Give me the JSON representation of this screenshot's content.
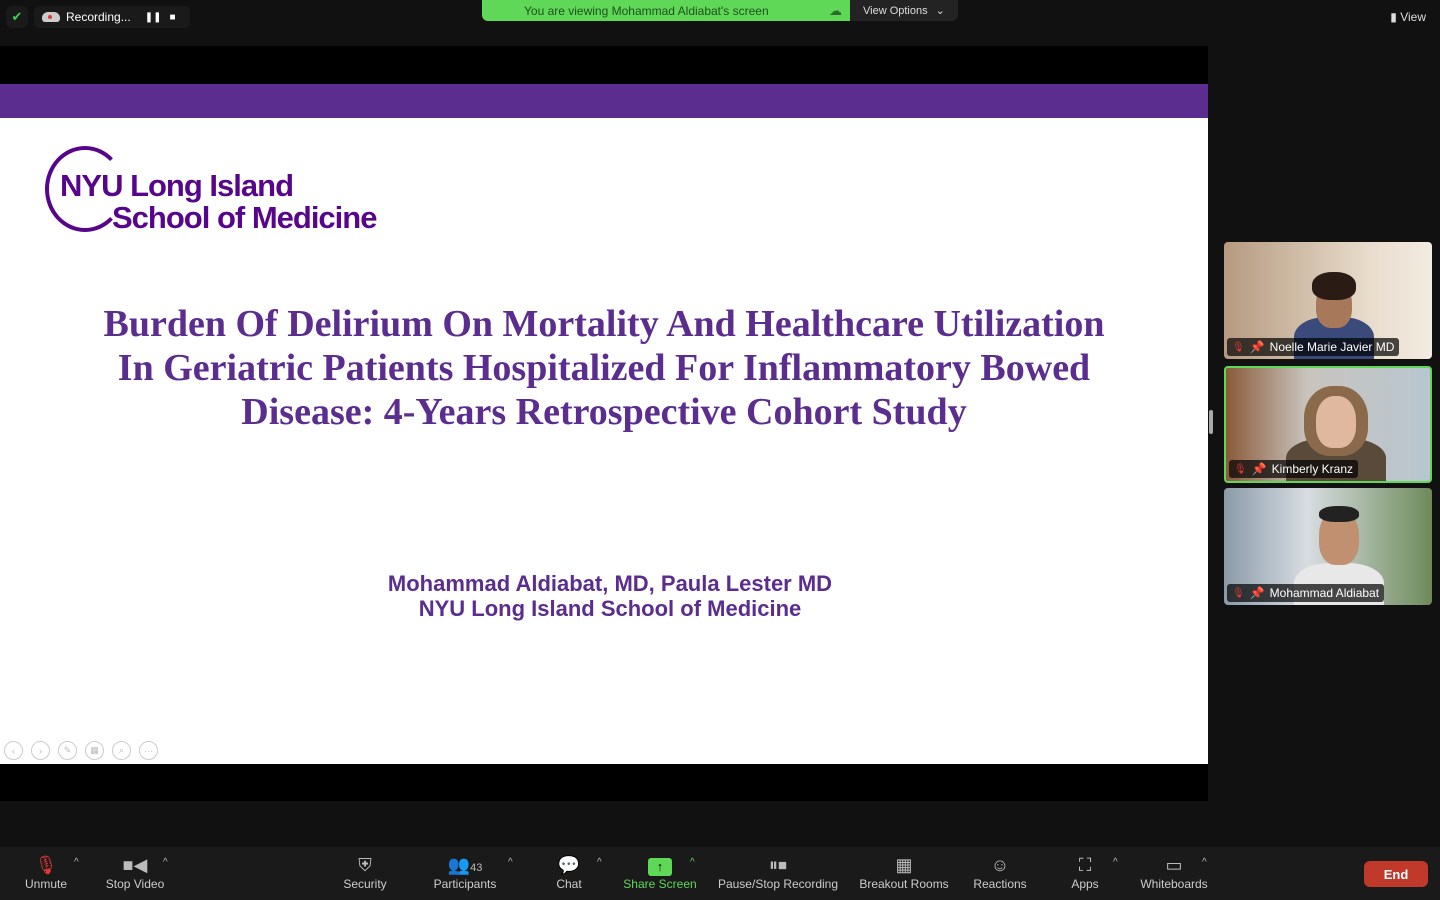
{
  "topbar": {
    "recording_label": "Recording...",
    "viewing_banner": "You are viewing Mohammad Aldiabat's screen",
    "view_options": "View Options",
    "view": "View"
  },
  "slide": {
    "logo_line1": "NYU Long Island",
    "logo_line2": "School of Medicine",
    "title": "Burden Of Delirium On Mortality And Healthcare Utilization In Geriatric Patients Hospitalized For Inflammatory Bowed Disease: 4-Years Retrospective Cohort Study",
    "authors": "Mohammad Aldiabat, MD, Paula Lester MD",
    "institution": "NYU Long Island School of Medicine"
  },
  "participants_video": [
    {
      "name": "Noelle Marie Javier MD"
    },
    {
      "name": "Kimberly Kranz"
    },
    {
      "name": "Mohammad Aldiabat"
    }
  ],
  "toolbar": {
    "unmute": "Unmute",
    "stop_video": "Stop Video",
    "security": "Security",
    "participants": "Participants",
    "participant_count": "43",
    "chat": "Chat",
    "share_screen": "Share Screen",
    "pause_stop_recording": "Pause/Stop Recording",
    "breakout_rooms": "Breakout Rooms",
    "reactions": "Reactions",
    "apps": "Apps",
    "whiteboards": "Whiteboards",
    "end": "End"
  },
  "colors": {
    "accent_green": "#5fd857",
    "slide_purple": "#5b2d8e",
    "end_red": "#c0392b"
  }
}
